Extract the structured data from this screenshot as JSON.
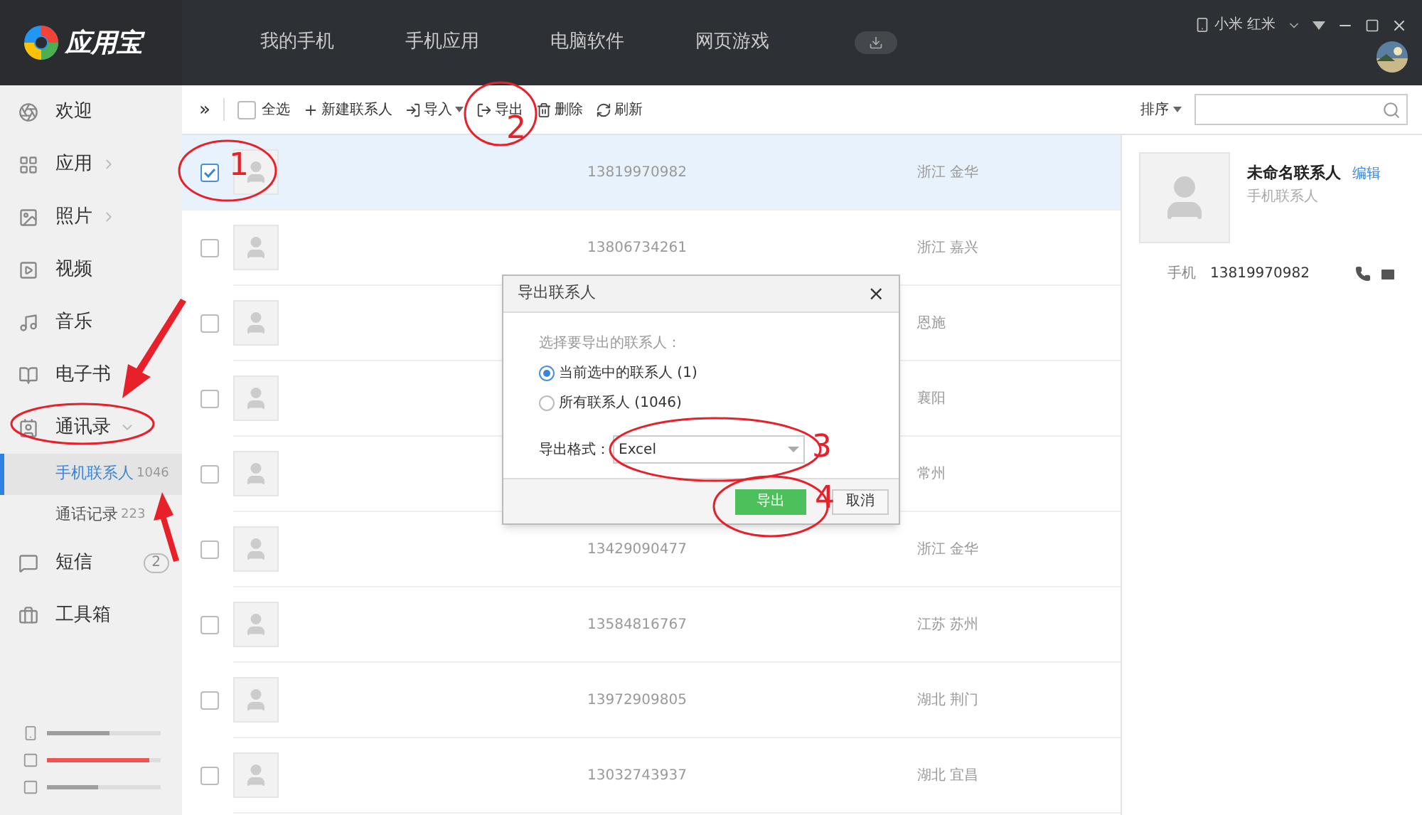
{
  "app": {
    "name": "应用宝"
  },
  "nav": [
    {
      "label": "我的手机",
      "selected": false
    },
    {
      "label": "手机应用",
      "selected": false
    },
    {
      "label": "电脑软件",
      "selected": false
    },
    {
      "label": "网页游戏",
      "selected": false
    }
  ],
  "device": {
    "name": "小米 红米"
  },
  "sidebar": {
    "items": [
      {
        "label": "欢迎",
        "selected": false
      },
      {
        "label": "应用",
        "chevron": true,
        "selected": false
      },
      {
        "label": "照片",
        "chevron": true,
        "selected": false
      },
      {
        "label": "视频",
        "selected": false
      },
      {
        "label": "音乐",
        "selected": false
      },
      {
        "label": "电子书",
        "selected": false
      },
      {
        "label": "通讯录",
        "expanded": true,
        "selected": false,
        "children": [
          {
            "label": "手机联系人",
            "count": "1046",
            "selected": true
          },
          {
            "label": "通话记录",
            "count": "223",
            "selected": false
          }
        ]
      },
      {
        "label": "短信",
        "badge": "2",
        "selected": false
      },
      {
        "label": "工具箱",
        "selected": false
      }
    ],
    "storage": [
      {
        "level": 0.55,
        "color": "#9e9e9e"
      },
      {
        "level": 0.9,
        "color": "#ef5350"
      },
      {
        "level": 0.45,
        "color": "#9e9e9e"
      }
    ]
  },
  "toolbar": {
    "collapse": "»",
    "select_all": {
      "label": "全选",
      "checked": false
    },
    "buttons": [
      {
        "label": "新建联系人"
      },
      {
        "label": "导入",
        "dropdown": true
      },
      {
        "label": "导出"
      },
      {
        "label": "删除"
      },
      {
        "label": "刷新"
      }
    ],
    "sort": "排序"
  },
  "contacts": [
    {
      "phone": "13819970982",
      "location": "浙江 金华",
      "checked": true,
      "selected": true
    },
    {
      "phone": "13806734261",
      "location": "浙江 嘉兴",
      "checked": false,
      "selected": false
    },
    {
      "location": "恩施",
      "checked": false,
      "selected": false
    },
    {
      "location": "襄阳",
      "checked": false,
      "selected": false
    },
    {
      "location": "常州",
      "checked": false,
      "selected": false
    },
    {
      "phone": "13429090477",
      "location": "浙江 金华",
      "checked": false,
      "selected": false
    },
    {
      "phone": "13584816767",
      "location": "江苏 苏州",
      "checked": false,
      "selected": false
    },
    {
      "phone": "13972909805",
      "location": "湖北 荆门",
      "checked": false,
      "selected": false
    },
    {
      "phone": "13032743937",
      "location": "湖北 宜昌",
      "checked": false,
      "selected": false
    }
  ],
  "detail": {
    "name": "未命名联系人",
    "edit": "编辑",
    "group": "手机联系人",
    "field_label": "手机",
    "phone": "13819970982"
  },
  "dialog": {
    "title": "导出联系人",
    "close": "×",
    "prompt": "选择要导出的联系人：",
    "options": [
      {
        "label": "当前选中的联系人 (1)",
        "selected": true
      },
      {
        "label": "所有联系人 (1046)",
        "selected": false
      }
    ],
    "format_label": "导出格式：",
    "format": "Excel",
    "confirm": "导出",
    "cancel": "取消"
  },
  "annotations": [
    {
      "label": "1"
    },
    {
      "label": "2"
    },
    {
      "label": "3"
    },
    {
      "label": "4"
    }
  ]
}
